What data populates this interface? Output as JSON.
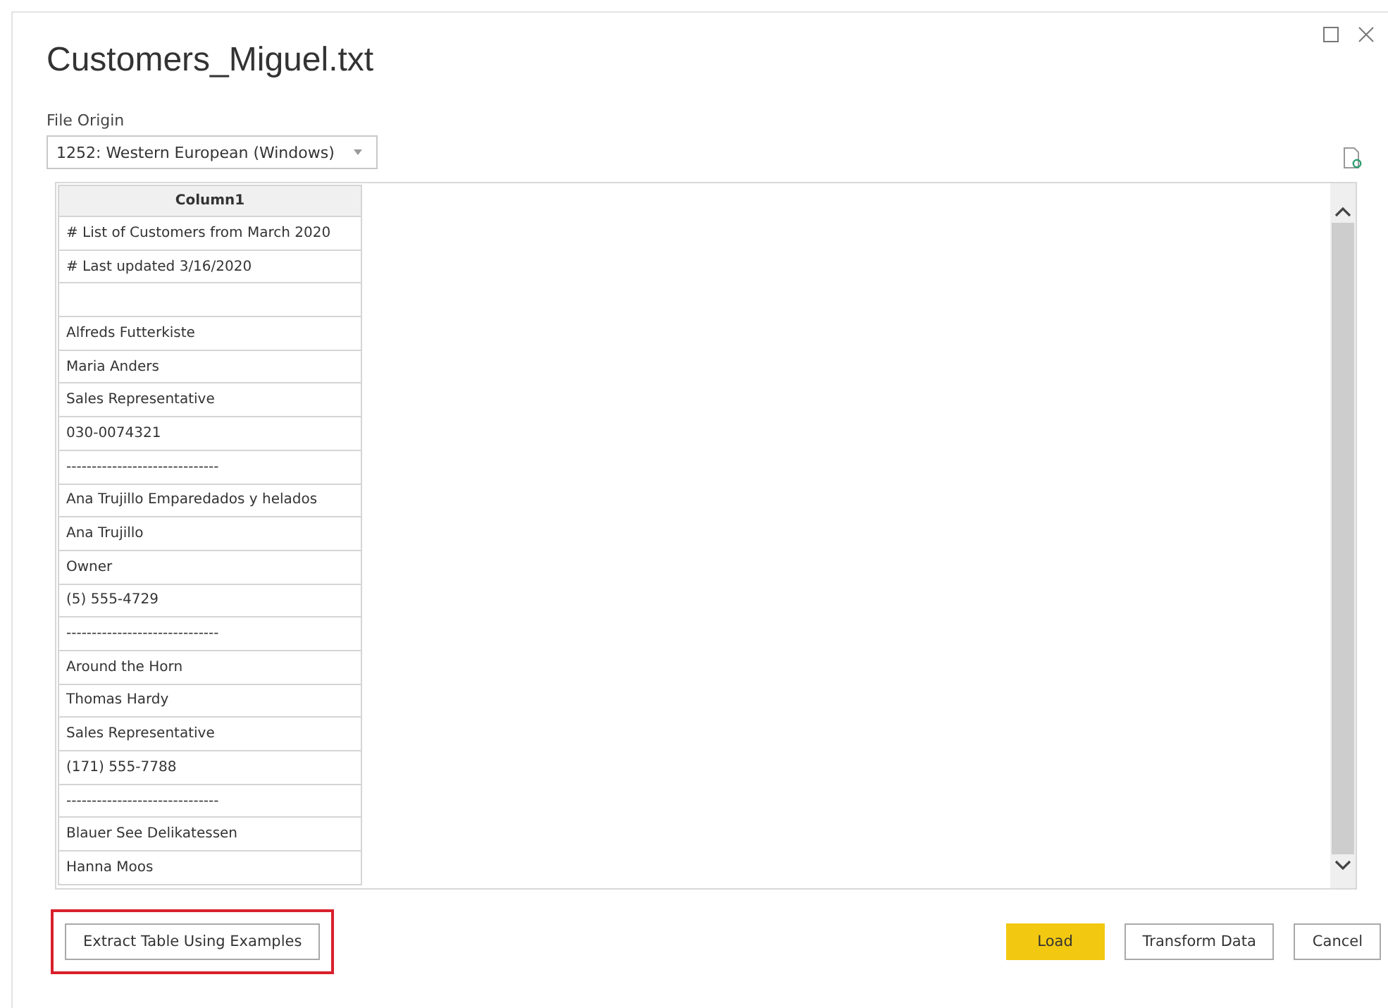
{
  "window": {
    "title": "Customers_Miguel.txt"
  },
  "file_origin": {
    "label": "File Origin",
    "value": "1252: Western European (Windows)"
  },
  "table": {
    "columns": [
      "Column1"
    ],
    "rows": [
      "# List of Customers from March 2020",
      "# Last updated 3/16/2020",
      "",
      "Alfreds Futterkiste",
      "Maria Anders",
      "Sales Representative",
      "030-0074321",
      "------------------------------",
      "Ana Trujillo Emparedados y helados",
      "Ana Trujillo",
      "Owner",
      "(5) 555-4729",
      "------------------------------",
      "Around the Horn",
      "Thomas Hardy",
      "Sales Representative",
      "(171) 555-7788",
      "------------------------------",
      "Blauer See Delikatessen",
      "Hanna Moos"
    ]
  },
  "extract_button": {
    "label": "Extract Table Using Examples",
    "highlighted": true
  },
  "buttons": [
    {
      "label": "Load",
      "kind": "primary"
    },
    {
      "label": "Transform Data",
      "kind": "default"
    },
    {
      "label": "Cancel",
      "kind": "default"
    }
  ]
}
